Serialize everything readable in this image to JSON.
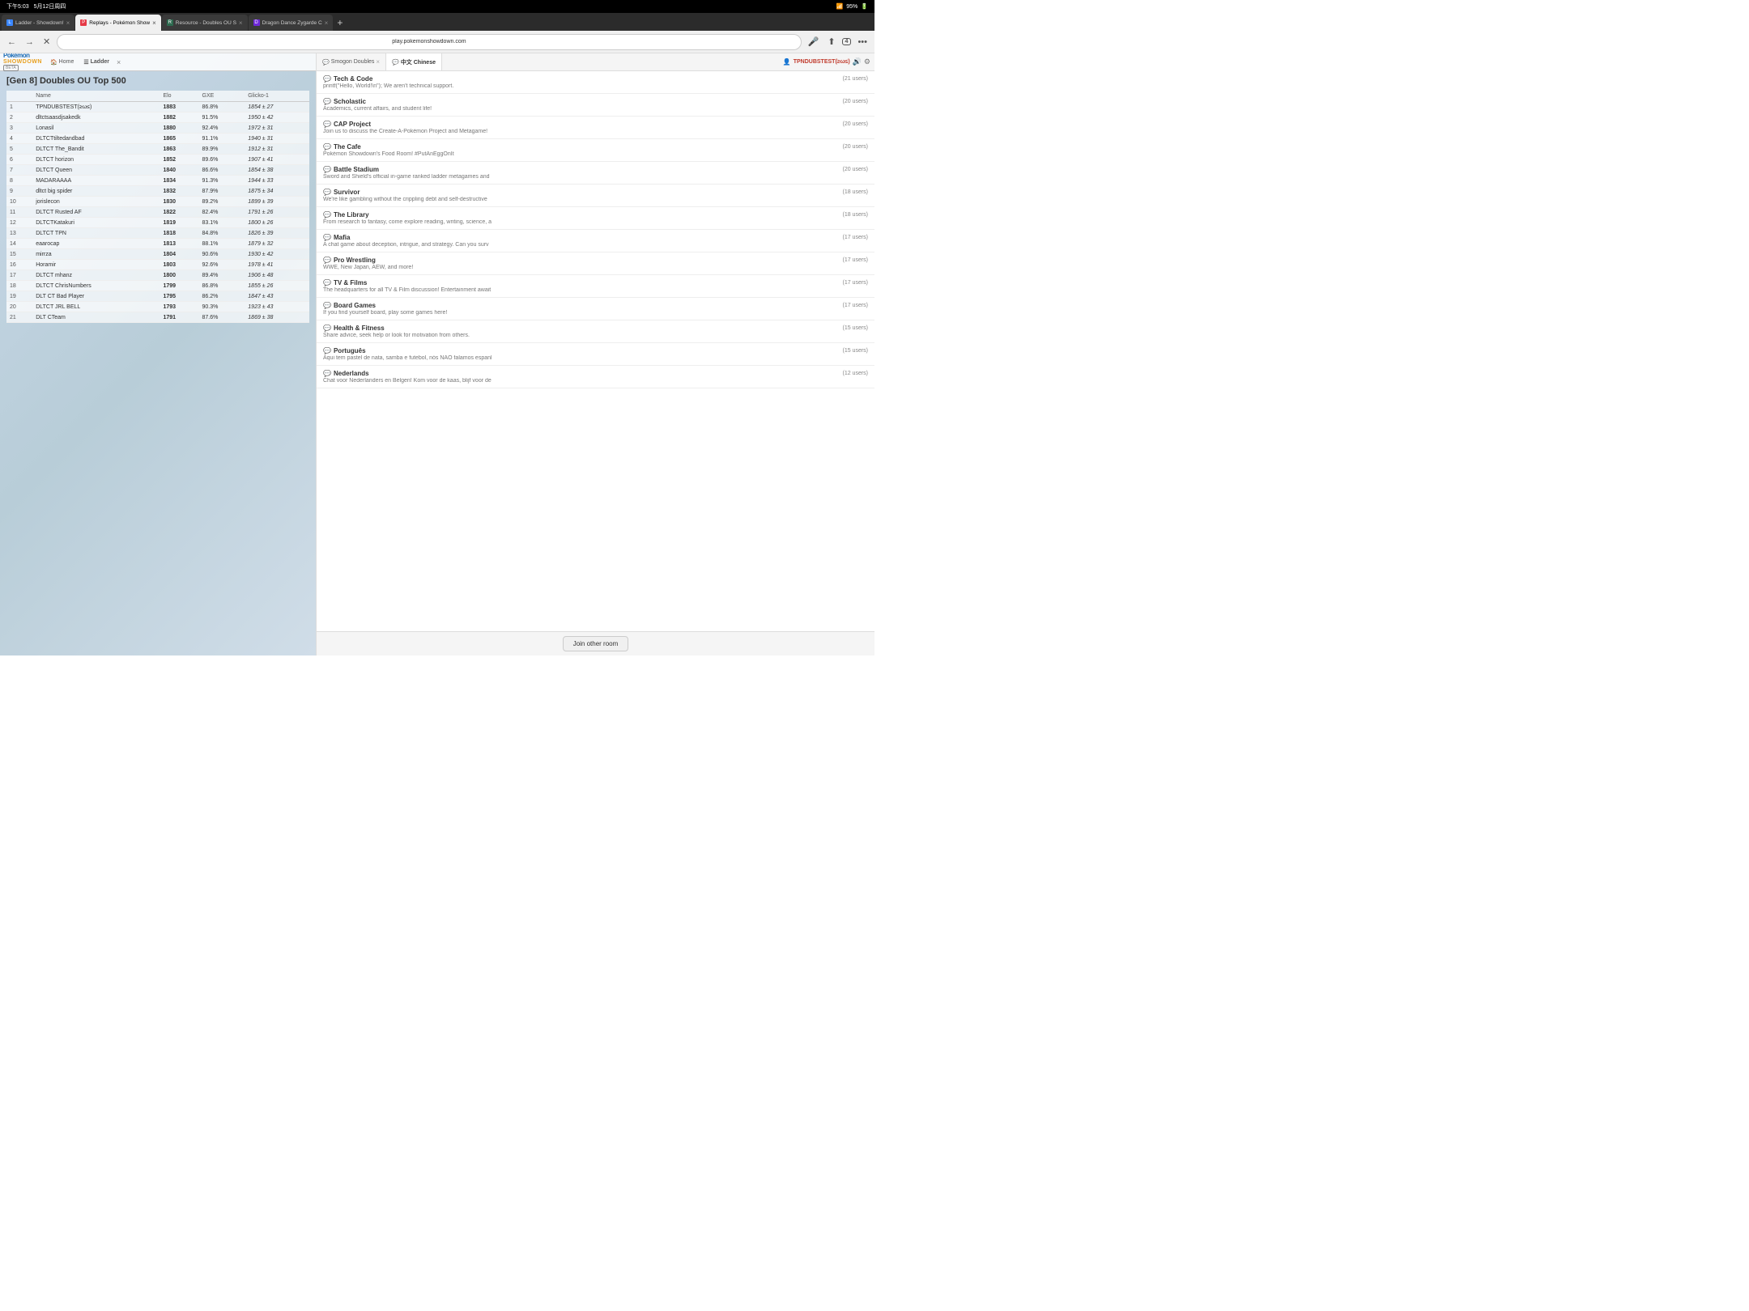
{
  "statusBar": {
    "time": "下午5:03",
    "date": "5月12日周四",
    "wifi": "WiFi",
    "battery": "95%"
  },
  "tabs": [
    {
      "id": "tab1",
      "title": "Ladder - Showdown!",
      "favicon": "L",
      "active": false
    },
    {
      "id": "tab2",
      "title": "Replays - Pokémon Show",
      "favicon": "P",
      "active": true
    },
    {
      "id": "tab3",
      "title": "Resource - Doubles OU S",
      "favicon": "R",
      "active": false
    },
    {
      "id": "tab4",
      "title": "Dragon Dance Zygarde C",
      "favicon": "D",
      "active": false
    }
  ],
  "addressBar": {
    "url": "play.pokemonshowdown.com"
  },
  "psHeader": {
    "homeLabel": "Home",
    "ladderLabel": "Ladder"
  },
  "chatTabs": [
    {
      "id": "smogon",
      "label": "Smogon Doubles",
      "active": false
    },
    {
      "id": "chinese",
      "label": "中文 Chinese",
      "active": true
    }
  ],
  "username": "TPNDUBSTEST(≥ω≤)",
  "ladderTitle": "[Gen 8] Doubles OU Top 500",
  "ladderColumns": [
    "",
    "Name",
    "Elo",
    "GXE",
    "Glicko-1"
  ],
  "ladderRows": [
    {
      "rank": 1,
      "name": "TPNDUBSTEST(≥ω≤)",
      "elo": 1883,
      "gxe": "86.8%",
      "glicko": "1854 ± 27"
    },
    {
      "rank": 2,
      "name": "dltctsaasdjsakedk",
      "elo": 1882,
      "gxe": "91.5%",
      "glicko": "1950 ± 42"
    },
    {
      "rank": 3,
      "name": "Lonasil",
      "elo": 1880,
      "gxe": "92.4%",
      "glicko": "1972 ± 31"
    },
    {
      "rank": 4,
      "name": "DLTCTtiltedandbad",
      "elo": 1865,
      "gxe": "91.1%",
      "glicko": "1940 ± 31"
    },
    {
      "rank": 5,
      "name": "DLTCT The_Bandit",
      "elo": 1863,
      "gxe": "89.9%",
      "glicko": "1912 ± 31"
    },
    {
      "rank": 6,
      "name": "DLTCT horizon",
      "elo": 1852,
      "gxe": "89.6%",
      "glicko": "1907 ± 41"
    },
    {
      "rank": 7,
      "name": "DLTCT Queen",
      "elo": 1840,
      "gxe": "86.6%",
      "glicko": "1854 ± 38"
    },
    {
      "rank": 8,
      "name": "MADARAAAA",
      "elo": 1834,
      "gxe": "91.3%",
      "glicko": "1944 ± 33"
    },
    {
      "rank": 9,
      "name": "dltct big spider",
      "elo": 1832,
      "gxe": "87.9%",
      "glicko": "1875 ± 34"
    },
    {
      "rank": 10,
      "name": "jorislecon",
      "elo": 1830,
      "gxe": "89.2%",
      "glicko": "1899 ± 39"
    },
    {
      "rank": 11,
      "name": "DLTCT Rusted AF",
      "elo": 1822,
      "gxe": "82.4%",
      "glicko": "1791 ± 26"
    },
    {
      "rank": 12,
      "name": "DLTCTKatakuri",
      "elo": 1819,
      "gxe": "83.1%",
      "glicko": "1800 ± 26"
    },
    {
      "rank": 13,
      "name": "DLTCT TPN",
      "elo": 1818,
      "gxe": "84.8%",
      "glicko": "1826 ± 39"
    },
    {
      "rank": 14,
      "name": "eaarocap",
      "elo": 1813,
      "gxe": "88.1%",
      "glicko": "1879 ± 32"
    },
    {
      "rank": 15,
      "name": "mirrza",
      "elo": 1804,
      "gxe": "90.6%",
      "glicko": "1930 ± 42"
    },
    {
      "rank": 16,
      "name": "Horamir",
      "elo": 1803,
      "gxe": "92.6%",
      "glicko": "1978 ± 41"
    },
    {
      "rank": 17,
      "name": "DLTCT mhanz",
      "elo": 1800,
      "gxe": "89.4%",
      "glicko": "1906 ± 48"
    },
    {
      "rank": 18,
      "name": "DLTCT ChrisNumbers",
      "elo": 1799,
      "gxe": "86.8%",
      "glicko": "1855 ± 26"
    },
    {
      "rank": 19,
      "name": "DLT CT Bad Player",
      "elo": 1795,
      "gxe": "86.2%",
      "glicko": "1847 ± 43"
    },
    {
      "rank": 20,
      "name": "DLTCT JRL BELL",
      "elo": 1793,
      "gxe": "90.3%",
      "glicko": "1923 ± 43"
    },
    {
      "rank": 21,
      "name": "DLT CTeam",
      "elo": 1791,
      "gxe": "87.6%",
      "glicko": "1869 ± 38"
    }
  ],
  "rooms": [
    {
      "name": "Tech & Code",
      "users": "(21 users)",
      "desc": "printf(\"Hello, World!\\n\"); We aren't technical support."
    },
    {
      "name": "Scholastic",
      "users": "(20 users)",
      "desc": "Academics, current affairs, and student life!"
    },
    {
      "name": "CAP Project",
      "users": "(20 users)",
      "desc": "Join us to discuss the Create-A-Pokémon Project and Metagame!"
    },
    {
      "name": "The Cafe",
      "users": "(20 users)",
      "desc": "Pokémon Showdown's Food Room! #PutAnEggOnIt"
    },
    {
      "name": "Battle Stadium",
      "users": "(20 users)",
      "desc": "Sword and Shield's official in-game ranked ladder metagames and"
    },
    {
      "name": "Survivor",
      "users": "(18 users)",
      "desc": "We're like gambling without the crippling debt and self-destructive"
    },
    {
      "name": "The Library",
      "users": "(18 users)",
      "desc": "From research to fantasy, come explore reading, writing, science, a"
    },
    {
      "name": "Mafia",
      "users": "(17 users)",
      "desc": "A chat game about deception, intrigue, and strategy. Can you surv"
    },
    {
      "name": "Pro Wrestling",
      "users": "(17 users)",
      "desc": "WWE, New Japan, AEW, and more!"
    },
    {
      "name": "TV & Films",
      "users": "(17 users)",
      "desc": "The headquarters for all TV & Film discussion! Entertainment await"
    },
    {
      "name": "Board Games",
      "users": "(17 users)",
      "desc": "If you find yourself board, play some games here!"
    },
    {
      "name": "Health & Fitness",
      "users": "(15 users)",
      "desc": "Share advice, seek help or look for motivation from others."
    },
    {
      "name": "Português",
      "users": "(15 users)",
      "desc": "Aqui tem pastel de nata, samba e futebol, nós NÃO falamos espanl"
    },
    {
      "name": "Nederlands",
      "users": "(12 users)",
      "desc": "Chat voor Nederlanders en Belgen! Kom voor de kaas, blijf voor de"
    }
  ],
  "joinRoomLabel": "Join other room"
}
